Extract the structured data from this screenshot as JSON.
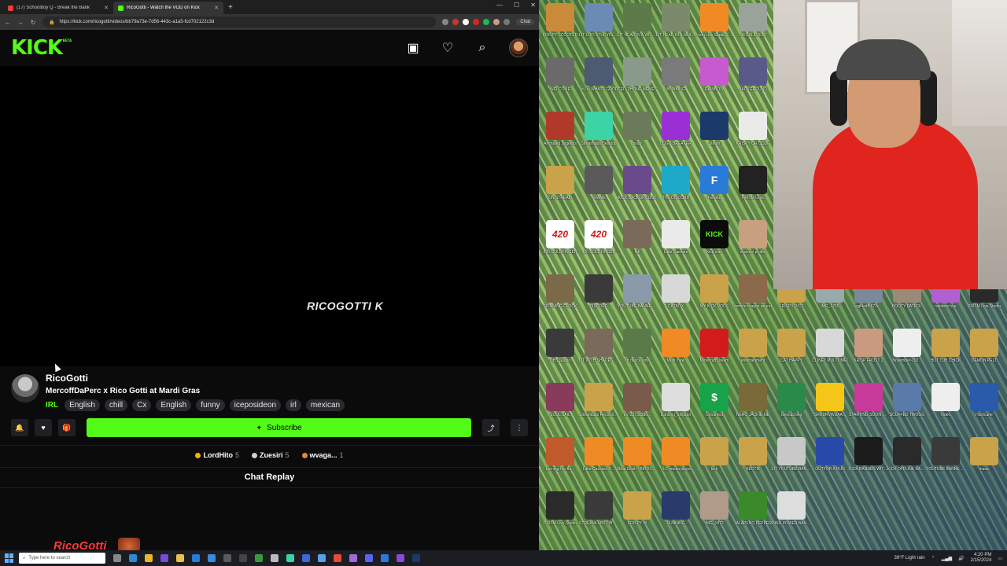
{
  "browser": {
    "tabs": [
      {
        "title": "(17) Schoolboy Q - Break the Bank",
        "fav_color": "#ff3b3b",
        "active": false
      },
      {
        "title": "RicoGotti - Watch the VOD on Kick",
        "fav_color": "#53fc18",
        "active": true
      }
    ],
    "url": "https://kick.com/ricogotti/videos/bb79a73e-7d56-443c-a1a5-fcd702122c3d",
    "chat_button": "Chat"
  },
  "kick": {
    "logo": "KICK",
    "logo_badge": "BETA",
    "video_watermark": "RICOGOTTI K",
    "channel_name": "RicoGotti",
    "stream_title": "MercoffDaPerc x Rico Gotti at Mardi Gras",
    "category": "IRL",
    "tags": [
      "English",
      "chill",
      "Cx",
      "English",
      "funny",
      "iceposideon",
      "irl",
      "mexican"
    ],
    "subscribe_label": "Subscribe",
    "gifters": [
      {
        "name": "LordHito",
        "count": "5",
        "color": "#f5b400"
      },
      {
        "name": "Zuesiri",
        "count": "5",
        "color": "#d0d0d0"
      },
      {
        "name": "wvaga...",
        "count": "1",
        "color": "#e0873a"
      }
    ],
    "chat_replay": "Chat Replay"
  },
  "overlay": {
    "name": "RicoGotti"
  },
  "desktop": {
    "icons": [
      {
        "label": "KRISPY SCOOTER",
        "color": "#c98a3a",
        "glyph": ""
      },
      {
        "label": "LIT LOFI STUDYING CLASSIC",
        "color": "#6b8bb5",
        "glyph": ""
      },
      {
        "label": "LIT HEAD IN A WITH FLAMES",
        "color": "#5d7a4a",
        "glyph": ""
      },
      {
        "label": "LIT HEAD IN A WHITE BACK",
        "color": "#7a8a6a",
        "glyph": ""
      },
      {
        "label": "Prism Live Studio EMOTES",
        "color": "#f08a24",
        "glyph": ""
      },
      {
        "label": "MEGALEVELS",
        "color": "#9aa39a",
        "glyph": ""
      },
      {
        "label": "WELCOME",
        "color": "#6a6a6a",
        "glyph": ""
      },
      {
        "label": "Lit Lol WHATS GOOD",
        "color": "#4c5a72",
        "glyph": ""
      },
      {
        "label": "CELLPHONE MEMES",
        "color": "#8a9a8a",
        "glyph": ""
      },
      {
        "label": "BLINKING",
        "color": "#7a7a7a",
        "glyph": ""
      },
      {
        "label": "RAINBOW",
        "color": "#c85ad0",
        "glyph": ""
      },
      {
        "label": "BACKGROUND",
        "color": "#5a5a8a",
        "glyph": ""
      },
      {
        "label": "Animated Legends",
        "color": "#b03a2a",
        "glyph": ""
      },
      {
        "label": "Streamlabs Desktop",
        "color": "#3cd3a6",
        "glyph": ""
      },
      {
        "label": "snap",
        "color": "#6a7a5a",
        "glyph": ""
      },
      {
        "label": "LOGO BREAKER",
        "color": "#9b2fd6",
        "glyph": ""
      },
      {
        "label": "Steam",
        "color": "#1b3a6a",
        "glyph": ""
      },
      {
        "label": "KRISPY QR CODE",
        "color": "#eaeaea",
        "glyph": ""
      },
      {
        "label": "ON STREAM",
        "color": "#caa24a",
        "glyph": ""
      },
      {
        "label": "FRAME",
        "color": "#5a5a5a",
        "glyph": ""
      },
      {
        "label": "KICK BACKGROUND",
        "color": "#6a4a8a",
        "glyph": ""
      },
      {
        "label": "THE DISCORD",
        "color": "#1fa9c9",
        "glyph": ""
      },
      {
        "label": "Fortnite",
        "color": "#2a7ad8",
        "glyph": "F"
      },
      {
        "label": "PRISM Lens",
        "color": "#222222",
        "glyph": ""
      },
      {
        "label": "420 GOLDFINGER",
        "color": "#ffffff",
        "glyph": "420"
      },
      {
        "label": "420 GOLDFINGER",
        "color": "#ffffff",
        "glyph": "420"
      },
      {
        "label": "lofi",
        "color": "#7a6a5a",
        "glyph": ""
      },
      {
        "label": "Little Caesars",
        "color": "#eaeaea",
        "glyph": ""
      },
      {
        "label": "Kick.com",
        "color": "#0b0b0b",
        "glyph": "KICK"
      },
      {
        "label": "channel profile",
        "color": "#c8a080",
        "glyph": ""
      },
      {
        "label": "SPINNING CLOCK",
        "color": "#7a6a4a",
        "glyph": ""
      },
      {
        "label": "DISCORD",
        "color": "#3a3a3a",
        "glyph": ""
      },
      {
        "label": "YOUTUBE BANNER NEW",
        "color": "#8a9aaa",
        "glyph": ""
      },
      {
        "label": "CATBOX",
        "color": "#d8d8d8",
        "glyph": ""
      },
      {
        "label": "MY KICK VODS",
        "color": "#caa24a",
        "glyph": ""
      },
      {
        "label": "fortnite dragon pound",
        "color": "#8a6a4a",
        "glyph": ""
      },
      {
        "label": "KRISPY PICS",
        "color": "#caa24a",
        "glyph": ""
      },
      {
        "label": "IMG_1765",
        "color": "#9aa",
        "glyph": ""
      },
      {
        "label": "egjf4sdf5672c...",
        "color": "#7a8a9a",
        "glyph": ""
      },
      {
        "label": "BOOTY PATROL",
        "color": "#9a8a7a",
        "glyph": ""
      },
      {
        "label": "rainbow hue",
        "color": "#b060d0",
        "glyph": ""
      },
      {
        "label": "PRISM Live Studio",
        "color": "#2a2a2a",
        "glyph": ""
      },
      {
        "label": "OBS Studio",
        "color": "#3a3a3a",
        "glyph": ""
      },
      {
        "label": "LIT WITH SHADES ON",
        "color": "#7a6a5a",
        "glyph": ""
      },
      {
        "label": "oh dance vinyl",
        "color": "#5a7a4a",
        "glyph": ""
      },
      {
        "label": "Multi_new",
        "color": "#f08a24",
        "glyph": ""
      },
      {
        "label": "MinecraftStream",
        "color": "#d21b1b",
        "glyph": ""
      },
      {
        "label": "entertainment",
        "color": "#caa24a",
        "glyph": ""
      },
      {
        "label": "CAT HAPPY",
        "color": "#caa24a",
        "glyph": ""
      },
      {
        "label": "CLINET MULTI IMEI",
        "color": "#d8d8d8",
        "glyph": ""
      },
      {
        "label": "KRISP FROST 2",
        "color": "#c89a80",
        "glyph": ""
      },
      {
        "label": "November-202...",
        "color": "#eeeeee",
        "glyph": ""
      },
      {
        "label": "HOT TUB CHICK",
        "color": "#caa24a",
        "glyph": ""
      },
      {
        "label": "DEMON PELT",
        "color": "#caa24a",
        "glyph": ""
      },
      {
        "label": "SOUL SAIL",
        "color": "#8a3a5a",
        "glyph": ""
      },
      {
        "label": "Streamlabs Recordings",
        "color": "#caa24a",
        "glyph": ""
      },
      {
        "label": "ex72373d386...",
        "color": "#7a5a4a",
        "glyph": ""
      },
      {
        "label": "Dancing_alligator",
        "color": "#dddddd",
        "glyph": ""
      },
      {
        "label": "Unnamed",
        "color": "#16a34a",
        "glyph": "$"
      },
      {
        "label": "NERO JACKIE ME",
        "color": "#7a6a3a",
        "glyph": ""
      },
      {
        "label": "Geocaching",
        "color": "#2a8a4a",
        "glyph": ""
      },
      {
        "label": "SRRDRVWUAA...",
        "color": "#f5c518",
        "glyph": ""
      },
      {
        "label": "STARTING SOON WOBBLE",
        "color": "#c83a9a",
        "glyph": ""
      },
      {
        "label": "SCUFFED TWOGG",
        "color": "#5a7aaa",
        "glyph": ""
      },
      {
        "label": "Video",
        "color": "#eeeeee",
        "glyph": ""
      },
      {
        "label": "Hurricane",
        "color": "#2a5aaa",
        "glyph": ""
      },
      {
        "label": "burning-fire-fla...",
        "color": "#c05a2a",
        "glyph": ""
      },
      {
        "label": "Little-Caesars-R...",
        "color": "#f08a24",
        "glyph": ""
      },
      {
        "label": "Billie Eilish - BIRDS OF...",
        "color": "#f08a24",
        "glyph": ""
      },
      {
        "label": "VLC media player",
        "color": "#f08a24",
        "glyph": ""
      },
      {
        "label": "kick",
        "color": "#caa24a",
        "glyph": ""
      },
      {
        "label": "HECTIK",
        "color": "#caa24a",
        "glyph": ""
      },
      {
        "label": "LIT YOUTUBE BANNER",
        "color": "#c8c8c8",
        "glyph": ""
      },
      {
        "label": "OUTFOR A RUN",
        "color": "#2a4aaa",
        "glyph": ""
      },
      {
        "label": "KICK BANNER WITH FLAMES",
        "color": "#1b1b1b",
        "glyph": ""
      },
      {
        "label": "KICK OFFLINE BANNER",
        "color": "#2a2a2a",
        "glyph": ""
      },
      {
        "label": "YOUTUBE BANNER FLAMES",
        "color": "#3a3a3a",
        "glyph": ""
      },
      {
        "label": "music",
        "color": "#caa24a",
        "glyph": ""
      },
      {
        "label": "PRISM Live Studio",
        "color": "#2a2a2a",
        "glyph": ""
      },
      {
        "label": "STREAMLABS OBS LOGIN...",
        "color": "#3a3a3a",
        "glyph": ""
      },
      {
        "label": "KRISPY W",
        "color": "#caa24a",
        "glyph": ""
      },
      {
        "label": "RUNNING",
        "color": "#2a3a6a",
        "glyph": ""
      },
      {
        "label": "IMG_1872",
        "color": "#b09a8a",
        "glyph": ""
      },
      {
        "label": "JALAPENO PEPPER",
        "color": "#3a8a2a",
        "glyph": ""
      },
      {
        "label": "INNU POWER BANK RETURN",
        "color": "#dddddd",
        "glyph": ""
      }
    ]
  },
  "taskbar": {
    "search_placeholder": "Type here to search",
    "weather": "39°F Light rain",
    "time": "4:20 PM",
    "date": "2/15/2024"
  }
}
